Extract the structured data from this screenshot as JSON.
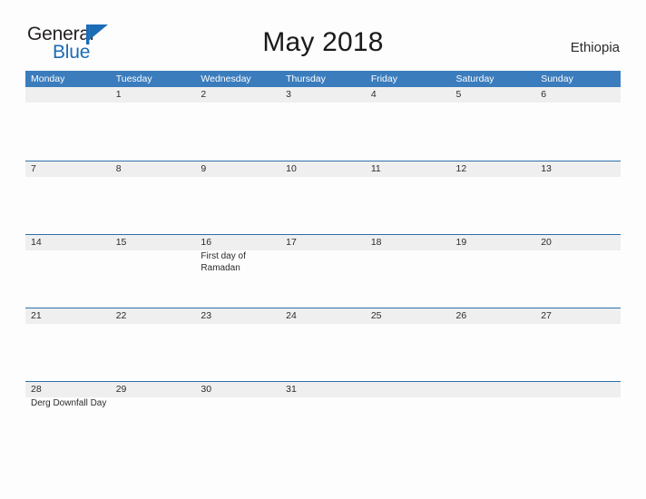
{
  "brand": {
    "name_part1": "General",
    "name_part2": "Blue",
    "flag_color": "#1b6cb5",
    "text_color": "#231f20"
  },
  "header": {
    "title": "May 2018",
    "country": "Ethiopia"
  },
  "theme": {
    "header_blue": "#3b7cbd",
    "row_border_blue": "#2f6fad",
    "date_band_gray": "#efefef",
    "page_background": "#fdfdfd",
    "text_color": "#2b2b2b"
  },
  "calendar": {
    "weekdays": [
      "Monday",
      "Tuesday",
      "Wednesday",
      "Thursday",
      "Friday",
      "Saturday",
      "Sunday"
    ],
    "weeks": [
      {
        "days": [
          {
            "date": "",
            "events": []
          },
          {
            "date": "1",
            "events": []
          },
          {
            "date": "2",
            "events": []
          },
          {
            "date": "3",
            "events": []
          },
          {
            "date": "4",
            "events": []
          },
          {
            "date": "5",
            "events": []
          },
          {
            "date": "6",
            "events": []
          }
        ]
      },
      {
        "days": [
          {
            "date": "7",
            "events": []
          },
          {
            "date": "8",
            "events": []
          },
          {
            "date": "9",
            "events": []
          },
          {
            "date": "10",
            "events": []
          },
          {
            "date": "11",
            "events": []
          },
          {
            "date": "12",
            "events": []
          },
          {
            "date": "13",
            "events": []
          }
        ]
      },
      {
        "days": [
          {
            "date": "14",
            "events": []
          },
          {
            "date": "15",
            "events": []
          },
          {
            "date": "16",
            "events": [
              "First day of",
              "Ramadan"
            ]
          },
          {
            "date": "17",
            "events": []
          },
          {
            "date": "18",
            "events": []
          },
          {
            "date": "19",
            "events": []
          },
          {
            "date": "20",
            "events": []
          }
        ]
      },
      {
        "days": [
          {
            "date": "21",
            "events": []
          },
          {
            "date": "22",
            "events": []
          },
          {
            "date": "23",
            "events": []
          },
          {
            "date": "24",
            "events": []
          },
          {
            "date": "25",
            "events": []
          },
          {
            "date": "26",
            "events": []
          },
          {
            "date": "27",
            "events": []
          }
        ]
      },
      {
        "days": [
          {
            "date": "28",
            "events": [
              "Derg Downfall Day"
            ]
          },
          {
            "date": "29",
            "events": []
          },
          {
            "date": "30",
            "events": []
          },
          {
            "date": "31",
            "events": []
          },
          {
            "date": "",
            "events": []
          },
          {
            "date": "",
            "events": []
          },
          {
            "date": "",
            "events": []
          }
        ]
      }
    ]
  }
}
